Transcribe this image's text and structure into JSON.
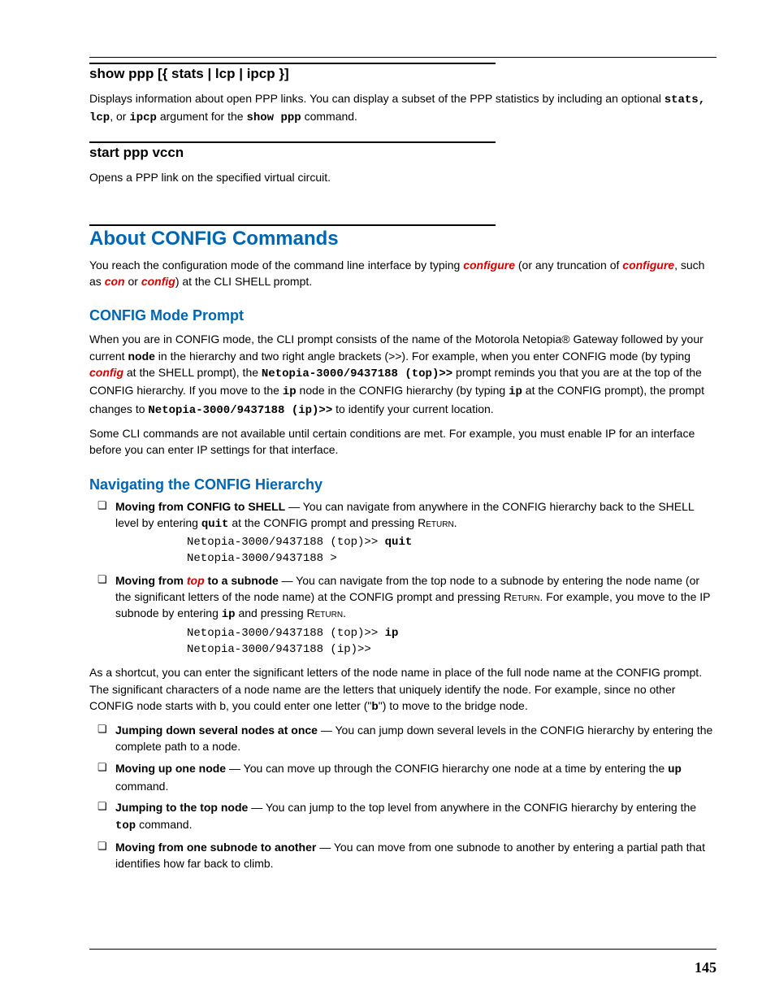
{
  "cmd1": {
    "title": "show ppp [{ stats | lcp | ipcp }]",
    "desc_a": "Displays information about open PPP links. You can display a subset of the PPP statistics by including an optional ",
    "arg1": "stats, lcp",
    "desc_b": ", or ",
    "arg2": "ipcp",
    "desc_c": " argument for the ",
    "arg3": "show ppp",
    "desc_d": " command."
  },
  "cmd2": {
    "title": "start ppp vccn",
    "desc": "Opens a PPP link on the specified virtual circuit."
  },
  "about": {
    "title": "About CONFIG Commands",
    "p1a": "You reach the configuration mode of the command line interface by typing ",
    "kw1": "configure",
    "p1b": " (or any truncation of ",
    "kw2": "configure",
    "p1c": ", such as ",
    "kw3": "con",
    "p1d": "  or  ",
    "kw4": "config",
    "p1e": ") at the CLI SHELL prompt."
  },
  "modeprompt": {
    "title": "CONFIG Mode Prompt",
    "p1a": "When you are in CONFIG mode, the CLI prompt consists of the name of the Motorola Netopia® Gateway followed by your current ",
    "node": "node",
    "p1b": " in the hierarchy and two right angle brackets (>>). For example, when you enter CONFIG mode (by typing ",
    "kw": "config",
    "p1c": " at the SHELL prompt), the ",
    "m1": "Netopia-3000/9437188 (top)>>",
    "p1d": " prompt reminds you that you are at the top of the CONFIG hierarchy. If you move to the ",
    "m2": "ip",
    "p1e": " node in the CONFIG hierarchy (by typing ",
    "m3": "ip",
    "p1f": " at the CONFIG prompt), the prompt changes to ",
    "m4": "Netopia-3000/9437188 (ip)>>",
    "p1g": " to identify your current location.",
    "p2": "Some CLI commands are not available until certain conditions are met. For example, you must enable IP for an interface before you can enter IP settings for that interface."
  },
  "nav": {
    "title": "Navigating the CONFIG Hierarchy",
    "li1": {
      "b": "Moving from CONFIG to SHELL",
      "t1": " — You can navigate from anywhere in the CONFIG hierarchy back to the SHELL level by entering ",
      "m": "quit",
      "t2": " at the CONFIG prompt and pressing ",
      "ret": "Return",
      "t3": ".",
      "code_a": "Netopia-3000/9437188 (top)>> ",
      "code_cmd": "quit",
      "code_b": "Netopia-3000/9437188 >"
    },
    "li2": {
      "b": "Moving from ",
      "kw": "top",
      "b2": " to a subnode",
      "t1": " — You can navigate from the top node to a subnode by entering the node name (or the significant letters of the node name) at the CONFIG prompt and pressing ",
      "ret1": "Return",
      "t2": ". For example, you move to the IP subnode by entering ",
      "m": "ip",
      "t3": " and pressing ",
      "ret2": "Return",
      "t4": ".",
      "code_a": "Netopia-3000/9437188 (top)>> ",
      "code_cmd": "ip",
      "code_b": "Netopia-3000/9437188 (ip)>>"
    },
    "shortcut_a": "As a shortcut, you can enter the significant letters of the node name in place of the full node name at the CONFIG prompt. The significant characters of a node name are the letters that uniquely identify the node. For example, since no other CONFIG node starts with b, you could enter one letter (\"",
    "shortcut_m": "b",
    "shortcut_b": "\") to move to the bridge node.",
    "li3": {
      "b": "Jumping down several nodes at once",
      "t": " — You can jump down several levels in the CONFIG hierarchy by entering the complete path to a node."
    },
    "li4": {
      "b": "Moving up one node",
      "t1": " — You can move up through the CONFIG hierarchy one node at a time by entering the ",
      "m": "up",
      "t2": " command."
    },
    "li5": {
      "b": "Jumping to the top node",
      "t1": " — You can jump to the top level from anywhere in the CONFIG hierarchy by entering the ",
      "m": "top",
      "t2": " command."
    },
    "li6": {
      "b": "Moving from one subnode to another",
      "t": " — You can move from one subnode to another by entering a partial path that identifies how far back to climb."
    }
  },
  "pagenum": "145"
}
